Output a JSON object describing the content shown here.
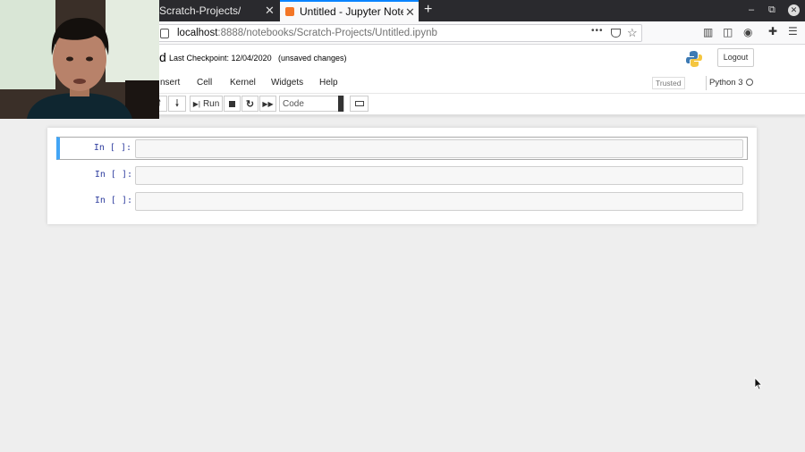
{
  "browser": {
    "tabs": [
      {
        "label": "Scratch-Projects/",
        "active": false
      },
      {
        "label": "Untitled - Jupyter Notebo",
        "active": true
      }
    ],
    "new_tab_glyph": "+",
    "tab_close_glyph": "✕",
    "window_controls": [
      "–",
      "⧉",
      "✕"
    ],
    "url_host": "localhost",
    "url_rest": ":8888/notebooks/Scratch-Projects/Untitled.ipynb",
    "url_menu_glyph": "•••"
  },
  "jupyter": {
    "title_fragment": "d",
    "checkpoint": "Last Checkpoint: 12/04/2020",
    "unsaved": "(unsaved changes)",
    "logout": "Logout",
    "menu": [
      "nsert",
      "Cell",
      "Kernel",
      "Widgets",
      "Help"
    ],
    "trusted": "Trusted",
    "kernel": "Python 3",
    "toolbar": {
      "run": "Run",
      "cell_type": "Code"
    },
    "cells": [
      {
        "prompt": "In [ ]:",
        "selected": true
      },
      {
        "prompt": "In [ ]:",
        "selected": false
      },
      {
        "prompt": "In [ ]:",
        "selected": false
      }
    ]
  },
  "colors": {
    "accent": "#42a5f5",
    "prompt": "#303f9f",
    "tab_active_border": "#0a84ff"
  }
}
